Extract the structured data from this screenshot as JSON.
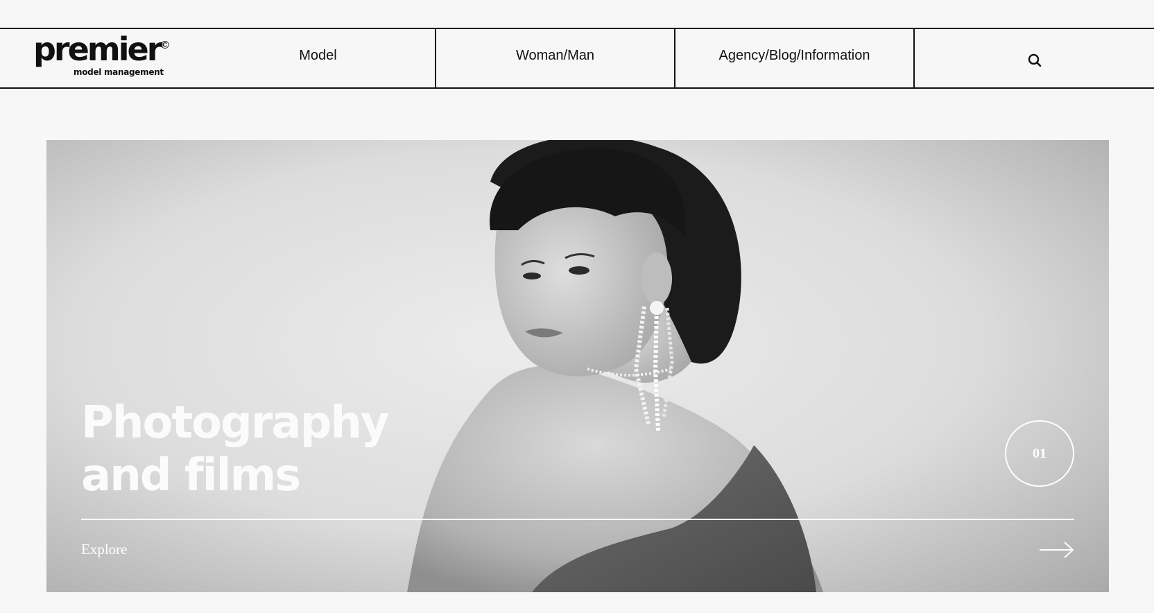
{
  "brand": {
    "name": "premier",
    "mark": "©",
    "tagline": "model management"
  },
  "nav": {
    "items": [
      {
        "label": "Model"
      },
      {
        "label": "Woman/Man"
      },
      {
        "label": "Agency/Blog/Information"
      }
    ],
    "search_icon": "search-icon"
  },
  "hero": {
    "title_line1": "Photography",
    "title_line2": "and films",
    "slide_number": "01",
    "cta_label": "Explore",
    "cta_icon": "arrow-right-icon",
    "image": "black-and-white portrait of a woman with dark bob hair and a long rhinestone earring, looking over her bare shoulder"
  },
  "colors": {
    "background": "#f7f7f7",
    "text": "#111111",
    "hero_text": "#ffffff"
  }
}
